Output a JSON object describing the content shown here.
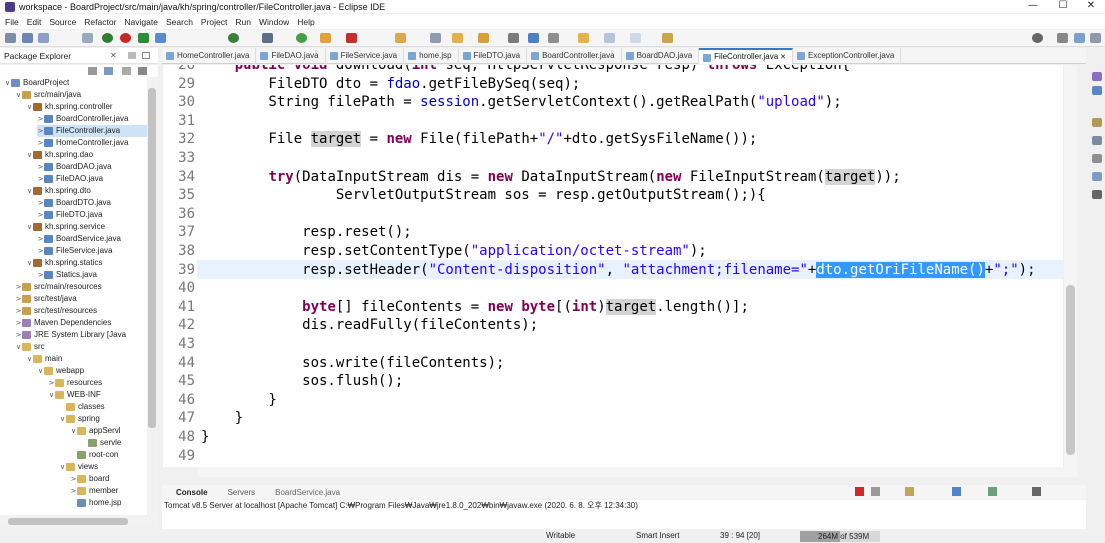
{
  "window": {
    "title": "workspace - BoardProject/src/main/java/kh/spring/controller/FileController.java - Eclipse IDE",
    "minimize": "—",
    "maximize": "☐",
    "close": "✕"
  },
  "menu": [
    "File",
    "Edit",
    "Source",
    "Refactor",
    "Navigate",
    "Search",
    "Project",
    "Run",
    "Window",
    "Help"
  ],
  "package_explorer": {
    "title": "Package Explorer",
    "tree": [
      {
        "label": "BoardProject",
        "depth": 0,
        "tw": "∨",
        "icon": "#6d8fc7"
      },
      {
        "label": "src/main/java",
        "depth": 1,
        "tw": "∨",
        "icon": "#c9a04c"
      },
      {
        "label": "kh.spring.controller",
        "depth": 2,
        "tw": "∨",
        "icon": "#a26a2f"
      },
      {
        "label": "BoardController.java",
        "depth": 3,
        "tw": ">",
        "icon": "#5a86c2"
      },
      {
        "label": "FileController.java",
        "depth": 3,
        "tw": ">",
        "icon": "#5a86c2",
        "selected": true
      },
      {
        "label": "HomeController.java",
        "depth": 3,
        "tw": ">",
        "icon": "#5a86c2"
      },
      {
        "label": "kh.spring.dao",
        "depth": 2,
        "tw": "∨",
        "icon": "#a26a2f"
      },
      {
        "label": "BoardDAO.java",
        "depth": 3,
        "tw": ">",
        "icon": "#5a86c2"
      },
      {
        "label": "FileDAO.java",
        "depth": 3,
        "tw": ">",
        "icon": "#5a86c2"
      },
      {
        "label": "kh.spring.dto",
        "depth": 2,
        "tw": "∨",
        "icon": "#a26a2f"
      },
      {
        "label": "BoardDTO.java",
        "depth": 3,
        "tw": ">",
        "icon": "#5a86c2"
      },
      {
        "label": "FileDTO.java",
        "depth": 3,
        "tw": ">",
        "icon": "#5a86c2"
      },
      {
        "label": "kh.spring.service",
        "depth": 2,
        "tw": "∨",
        "icon": "#a26a2f"
      },
      {
        "label": "BoardService.java",
        "depth": 3,
        "tw": ">",
        "icon": "#5a86c2"
      },
      {
        "label": "FileService.java",
        "depth": 3,
        "tw": ">",
        "icon": "#5a86c2"
      },
      {
        "label": "kh.spring.statics",
        "depth": 2,
        "tw": "∨",
        "icon": "#a26a2f"
      },
      {
        "label": "Statics.java",
        "depth": 3,
        "tw": ">",
        "icon": "#5a86c2"
      },
      {
        "label": "src/main/resources",
        "depth": 1,
        "tw": ">",
        "icon": "#c9a04c"
      },
      {
        "label": "src/test/java",
        "depth": 1,
        "tw": ">",
        "icon": "#c9a04c"
      },
      {
        "label": "src/test/resources",
        "depth": 1,
        "tw": ">",
        "icon": "#c9a04c"
      },
      {
        "label": "Maven Dependencies",
        "depth": 1,
        "tw": ">",
        "icon": "#9a7fb8"
      },
      {
        "label": "JRE System Library [Java",
        "depth": 1,
        "tw": ">",
        "icon": "#9a7fb8"
      },
      {
        "label": "src",
        "depth": 1,
        "tw": "∨",
        "icon": "#d9b65a"
      },
      {
        "label": "main",
        "depth": 2,
        "tw": "∨",
        "icon": "#d9b65a"
      },
      {
        "label": "webapp",
        "depth": 3,
        "tw": "∨",
        "icon": "#d9b65a"
      },
      {
        "label": "resources",
        "depth": 4,
        "tw": ">",
        "icon": "#d9b65a"
      },
      {
        "label": "WEB-INF",
        "depth": 4,
        "tw": "∨",
        "icon": "#d9b65a"
      },
      {
        "label": "classes",
        "depth": 5,
        "tw": "",
        "icon": "#d9b65a"
      },
      {
        "label": "spring",
        "depth": 5,
        "tw": "∨",
        "icon": "#d9b65a"
      },
      {
        "label": "appServl",
        "depth": 6,
        "tw": "∨",
        "icon": "#d9b65a"
      },
      {
        "label": "servle",
        "depth": 7,
        "tw": "",
        "icon": "#8aa06b"
      },
      {
        "label": "root-con",
        "depth": 6,
        "tw": "",
        "icon": "#8aa06b"
      },
      {
        "label": "views",
        "depth": 5,
        "tw": "∨",
        "icon": "#d9b65a"
      },
      {
        "label": "board",
        "depth": 6,
        "tw": ">",
        "icon": "#d9b65a"
      },
      {
        "label": "member",
        "depth": 6,
        "tw": ">",
        "icon": "#d9b65a"
      },
      {
        "label": "home.jsp",
        "depth": 6,
        "tw": "",
        "icon": "#6b8fb0"
      }
    ]
  },
  "editor_tabs": [
    "HomeController.java",
    "FileDAO.java",
    "FileService.java",
    "home.jsp",
    "FileDTO.java",
    "BoardController.java",
    "BoardDAO.java",
    "FileController.java",
    "ExceptionController.java"
  ],
  "active_tab": "FileController.java",
  "code_lines": [
    {
      "n": "28",
      "segs": [
        {
          "t": "    "
        },
        {
          "t": "public void ",
          "c": "kw"
        },
        {
          "t": "download("
        },
        {
          "t": "int ",
          "c": "kw"
        },
        {
          "t": "seq, HttpServletResponse resp) "
        },
        {
          "t": "throws ",
          "c": "kw"
        },
        {
          "t": "Exception{"
        }
      ]
    },
    {
      "n": "29",
      "segs": [
        {
          "t": "        FileDTO dto = "
        },
        {
          "t": "fdao",
          "c": "fld"
        },
        {
          "t": ".getFileBySeq(seq);"
        }
      ]
    },
    {
      "n": "30",
      "segs": [
        {
          "t": "        String filePath = "
        },
        {
          "t": "session",
          "c": "fld"
        },
        {
          "t": ".getServletContext().getRealPath("
        },
        {
          "t": "\"upload\"",
          "c": "str"
        },
        {
          "t": ");"
        }
      ]
    },
    {
      "n": "31",
      "segs": []
    },
    {
      "n": "32",
      "segs": [
        {
          "t": "        File "
        },
        {
          "t": "target",
          "c": "occ"
        },
        {
          "t": " = "
        },
        {
          "t": "new ",
          "c": "kw"
        },
        {
          "t": "File(filePath+"
        },
        {
          "t": "\"/\"",
          "c": "str"
        },
        {
          "t": "+dto.getSysFileName());"
        }
      ]
    },
    {
      "n": "33",
      "segs": []
    },
    {
      "n": "34",
      "segs": [
        {
          "t": "        "
        },
        {
          "t": "try",
          "c": "kw"
        },
        {
          "t": "(DataInputStream dis = "
        },
        {
          "t": "new ",
          "c": "kw"
        },
        {
          "t": "DataInputStream("
        },
        {
          "t": "new ",
          "c": "kw"
        },
        {
          "t": "FileInputStream("
        },
        {
          "t": "target",
          "c": "occ"
        },
        {
          "t": "));"
        }
      ]
    },
    {
      "n": "35",
      "segs": [
        {
          "t": "                ServletOutputStream sos = resp.getOutputStream();){"
        }
      ]
    },
    {
      "n": "36",
      "segs": []
    },
    {
      "n": "37",
      "segs": [
        {
          "t": "            resp.reset();"
        }
      ]
    },
    {
      "n": "38",
      "segs": [
        {
          "t": "            resp.setContentType("
        },
        {
          "t": "\"application/octet-stream\"",
          "c": "str"
        },
        {
          "t": ");"
        }
      ]
    },
    {
      "n": "39",
      "segs": [
        {
          "t": "            resp.setHeader("
        },
        {
          "t": "\"Content-disposition\"",
          "c": "str"
        },
        {
          "t": ", "
        },
        {
          "t": "\"attachment;filename=\"",
          "c": "str"
        },
        {
          "t": "+"
        },
        {
          "t": "dto.getOriFileName()",
          "c": "selt"
        },
        {
          "t": "+"
        },
        {
          "t": "\";\"",
          "c": "str"
        },
        {
          "t": ");"
        }
      ]
    },
    {
      "n": "40",
      "segs": []
    },
    {
      "n": "41",
      "segs": [
        {
          "t": "            "
        },
        {
          "t": "byte",
          "c": "kw"
        },
        {
          "t": "[] fileContents = "
        },
        {
          "t": "new ",
          "c": "kw"
        },
        {
          "t": "byte",
          "c": "kw"
        },
        {
          "t": "[("
        },
        {
          "t": "int",
          "c": "kw"
        },
        {
          "t": ")"
        },
        {
          "t": "target",
          "c": "occ"
        },
        {
          "t": ".length()];"
        }
      ]
    },
    {
      "n": "42",
      "segs": [
        {
          "t": "            dis.readFully(fileContents);"
        }
      ]
    },
    {
      "n": "43",
      "segs": []
    },
    {
      "n": "44",
      "segs": [
        {
          "t": "            sos.write(fileContents);"
        }
      ]
    },
    {
      "n": "45",
      "segs": [
        {
          "t": "            sos.flush();"
        }
      ]
    },
    {
      "n": "46",
      "segs": [
        {
          "t": "        }"
        }
      ]
    },
    {
      "n": "47",
      "segs": [
        {
          "t": "    }"
        }
      ]
    },
    {
      "n": "48",
      "segs": [
        {
          "t": "}"
        }
      ]
    },
    {
      "n": "49",
      "segs": []
    }
  ],
  "console": {
    "tabs": [
      "Console",
      "Servers",
      "BoardService.java"
    ],
    "text": "Tomcat v8.5 Server at localhost [Apache Tomcat] C:₩Program Files₩Java₩jre1.8.0_202₩bin₩javaw.exe (2020. 6. 8. 오후 12:34:30)"
  },
  "status": {
    "writable": "Writable",
    "insert": "Smart Insert",
    "position": "39 : 94 [20]",
    "heap": "264M of 539M"
  }
}
